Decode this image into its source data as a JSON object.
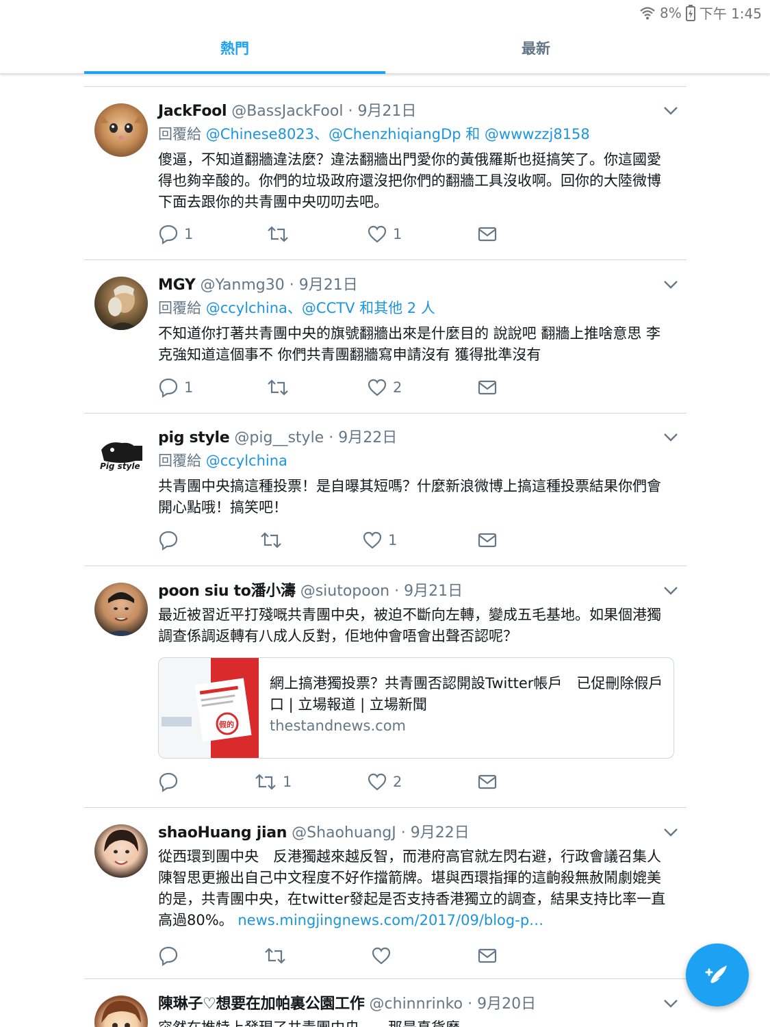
{
  "status_bar": {
    "battery": "8%",
    "time": "下午 1:45"
  },
  "tabs": [
    {
      "label": "熱門"
    },
    {
      "label": "最新"
    }
  ],
  "tweets": [
    {
      "name": "JackFool",
      "handle": "@BassJackFool",
      "separator": "·",
      "date": "9月21日",
      "reply_prefix": "回覆給",
      "reply_to": "@Chinese8023、@ChenzhiqiangDp 和 @wwwzzj8158",
      "text": "傻逼，不知道翻牆違法麼？違法翻牆出門愛你的黃俄羅斯也挺搞笑了。你這國愛得也夠辛酸的。你們的垃圾政府還沒把你們的翻牆工具沒收啊。回你的大陸微博下面去跟你的共青團中央叨叨去吧。",
      "replies": "1",
      "retweets": "",
      "likes": "1"
    },
    {
      "name": "MGY",
      "handle": "@Yanmg30",
      "separator": "·",
      "date": "9月21日",
      "reply_prefix": "回覆給",
      "reply_to": "@ccylchina、@CCTV 和其他 2 人",
      "text": "不知道你打著共青團中央的旗號翻牆出來是什麼目的 說說吧 翻牆上推啥意思 李克強知道這個事不 你們共青團翻牆寫申請沒有 獲得批準沒有",
      "replies": "1",
      "retweets": "",
      "likes": "2"
    },
    {
      "name": "pig style",
      "handle": "@pig__style",
      "separator": "·",
      "date": "9月22日",
      "reply_prefix": "回覆給",
      "reply_to": "@ccylchina",
      "text": "共青團中央搞這種投票！是自曝其短嗎？什麼新浪微博上搞這種投票結果你們會開心點哦！搞笑吧！",
      "replies": "",
      "retweets": "",
      "likes": "1",
      "avatar_text": "Pig style"
    },
    {
      "name": "poon siu to潘小濤",
      "handle": "@siutopoon",
      "separator": "·",
      "date": "9月21日",
      "text": "最近被習近平打殘嘅共青團中央，被迫不斷向左轉，變成五毛基地。如果個港獨調查係調返轉有八成人反對，佢地仲會唔會出聲否認呢？",
      "card": {
        "title": "網上搞港獨投票？共青團否認開設Twitter帳戶　已促刪除假戶口 | 立場報道 | 立場新聞",
        "domain": "thestandnews.com",
        "thumb_stamp": "假的"
      },
      "replies": "",
      "retweets": "1",
      "likes": "2"
    },
    {
      "name": "shaoHuang jian",
      "handle": "@ShaohuangJ",
      "separator": "·",
      "date": "9月22日",
      "text": "從西環到團中央　反港獨越來越反智，而港府高官就左閃右避，行政會議召集人陳智思更搬出自己中文程度不好作擋箭牌。堪與西環指揮的這齣殺無赦鬧劇媲美的是，共青團中央，在twitter發起是否支持香港獨立的調查，結果支持比率一直高過80%。",
      "link": "news.mingjingnews.com/2017/09/blog-p…",
      "replies": "",
      "retweets": "",
      "likes": ""
    },
    {
      "name": "陳琳子♡想要在加帕裏公園工作",
      "handle": "@chinnrinko",
      "separator": "·",
      "date": "9月20日",
      "text": "突然在推特上發現了共青團中央……那是真貨麼"
    }
  ],
  "colors": {
    "accent": "#1da1f2",
    "link": "#1b95e0",
    "muted": "#657786"
  },
  "icons": [
    "wifi-icon",
    "battery-icon",
    "chevron-down-icon",
    "reply-icon",
    "retweet-icon",
    "heart-icon",
    "message-icon",
    "compose-icon"
  ]
}
